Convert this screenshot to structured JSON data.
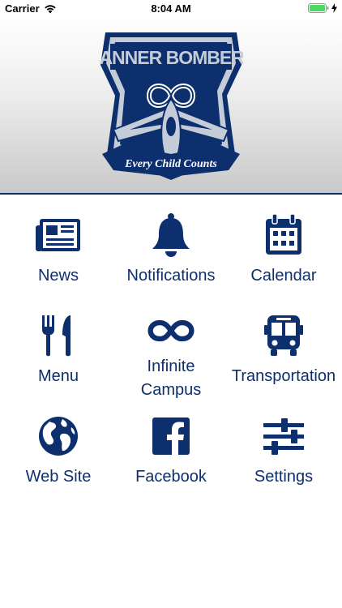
{
  "status_bar": {
    "carrier": "Carrier",
    "time": "8:04 AM"
  },
  "banner": {
    "logo_title": "BANNER BOMBERS",
    "logo_motto": "Every Child Counts",
    "colors": {
      "navy": "#0d2f6e",
      "silver": "#c4ccd8"
    }
  },
  "tiles": [
    {
      "label": "News",
      "icon": "newspaper-icon"
    },
    {
      "label": "Notifications",
      "icon": "bell-icon"
    },
    {
      "label": "Calendar",
      "icon": "calendar-icon"
    },
    {
      "label": "Menu",
      "icon": "fork-knife-icon"
    },
    {
      "label": "Infinite\nCampus",
      "icon": "infinity-icon"
    },
    {
      "label": "Transportation",
      "icon": "bus-icon"
    },
    {
      "label": "Web Site",
      "icon": "globe-icon"
    },
    {
      "label": "Facebook",
      "icon": "facebook-icon"
    },
    {
      "label": "Settings",
      "icon": "sliders-icon"
    }
  ],
  "accent_color": "#0d2f6e"
}
